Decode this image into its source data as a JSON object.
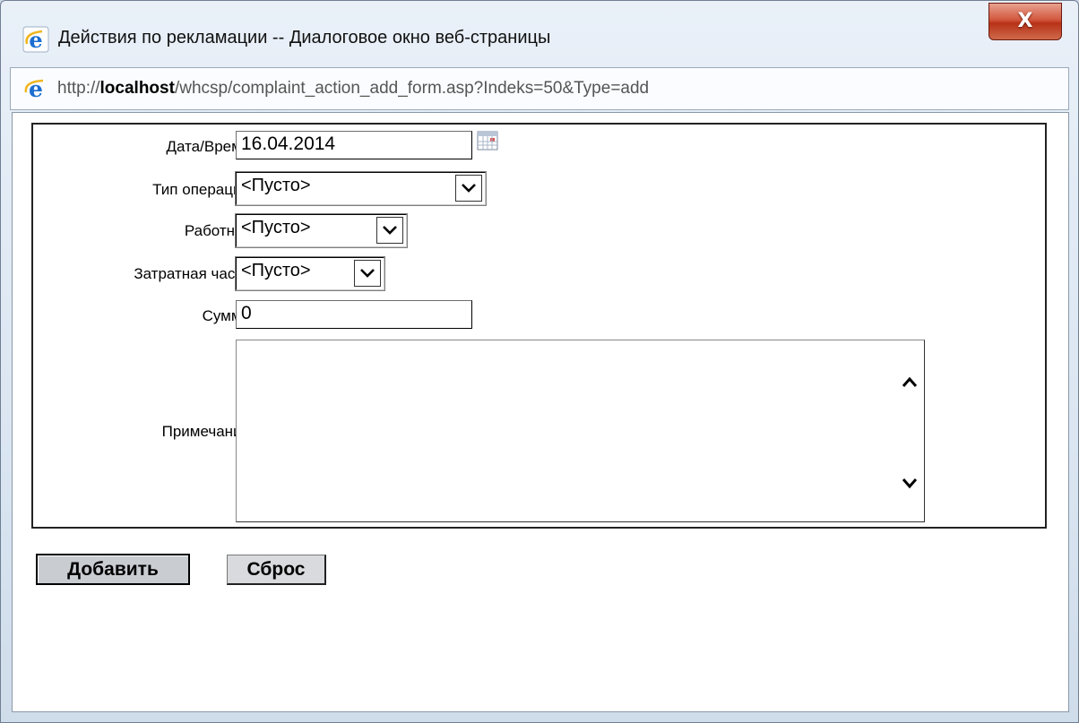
{
  "window": {
    "title": "Действия по рекламации -- Диалоговое окно веб-страницы",
    "close_label": "X",
    "url_prefix": "http://",
    "url_host": "localhost",
    "url_path": "/whcsp/complaint_action_add_form.asp?Indeks=50&Type=add"
  },
  "form": {
    "date_label": "Дата/Время",
    "date_value": "16.04.2014",
    "operation_type_label": "Тип операции",
    "operation_type_value": "<Пусто>",
    "worker_label": "Работник",
    "worker_value": "<Пусто>",
    "cost_part_label": "Затратная часть",
    "cost_part_value": "<Пусто>",
    "sum_label": "Сумма",
    "sum_value": "0",
    "note_label": "Примечание",
    "note_value": ""
  },
  "buttons": {
    "add_label": "Добавить",
    "reset_label": "Сброс"
  },
  "icons": {
    "title_icon": "ie-icon",
    "address_icon": "ie-icon",
    "calendar": "calendar-icon",
    "dropdown": "chevron-down-icon",
    "scroll_up": "chevron-up-icon",
    "scroll_down": "chevron-down-icon"
  },
  "colors": {
    "close_button": "#c8432a",
    "window_frame": "#dbe6f2",
    "ie_blue": "#1c6fd1",
    "ie_ring": "#f0b51c"
  }
}
